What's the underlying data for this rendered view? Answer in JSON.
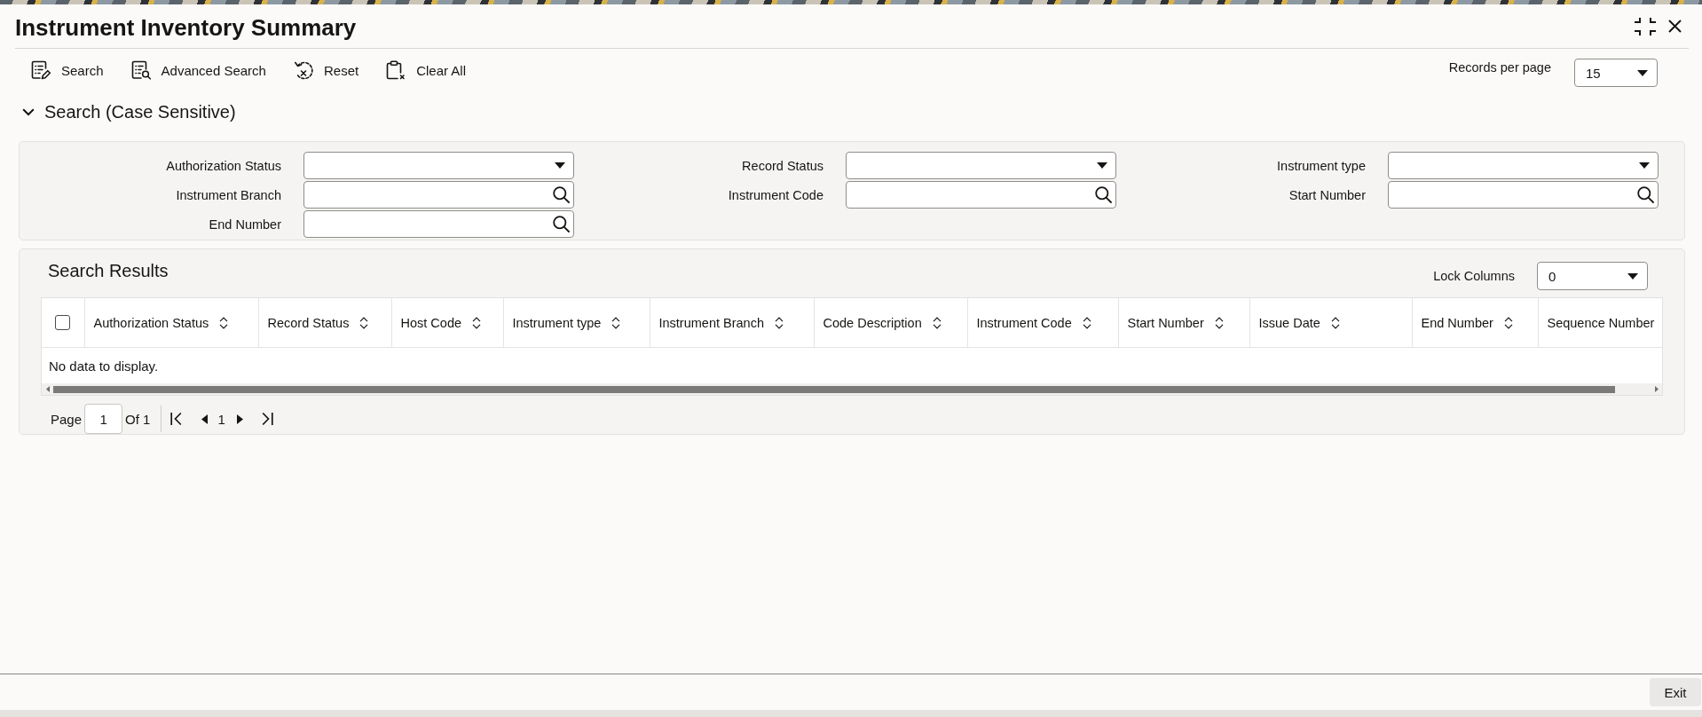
{
  "window": {
    "title": "Instrument Inventory Summary"
  },
  "toolbar": {
    "buttons": [
      {
        "label": "Search",
        "kind": "search"
      },
      {
        "label": "Advanced Search",
        "kind": "advanced"
      },
      {
        "label": "Reset",
        "kind": "reset"
      },
      {
        "label": "Clear All",
        "kind": "clear"
      }
    ],
    "records_per_page": {
      "label": "Records per page",
      "value": "15"
    }
  },
  "search_section": {
    "title": "Search (Case Sensitive)",
    "expanded": true,
    "fields": [
      {
        "label": "Authorization Status",
        "kind": "dropdown"
      },
      {
        "label": "Record Status",
        "kind": "dropdown"
      },
      {
        "label": "Instrument type",
        "kind": "dropdown"
      },
      {
        "label": "Instrument Branch",
        "kind": "lookup"
      },
      {
        "label": "Instrument Code",
        "kind": "lookup"
      },
      {
        "label": "Start Number",
        "kind": "lookup"
      },
      {
        "label": "End Number",
        "kind": "lookup"
      }
    ]
  },
  "results": {
    "title": "Search Results",
    "lock_columns": {
      "label": "Lock Columns",
      "value": "0"
    },
    "table": {
      "select_all": {
        "checked": false
      },
      "columns": [
        {
          "label": "Authorization Status"
        },
        {
          "label": "Record Status"
        },
        {
          "label": "Host Code"
        },
        {
          "label": "Instrument type"
        },
        {
          "label": "Instrument Branch"
        },
        {
          "label": "Code Description"
        },
        {
          "label": "Instrument Code"
        },
        {
          "label": "Start Number"
        },
        {
          "label": "Issue Date"
        },
        {
          "label": "End Number"
        },
        {
          "label": "Sequence Number"
        }
      ],
      "empty_message": "No data to display."
    },
    "pagination": {
      "label": "Page",
      "page": "1",
      "total": "Of 1",
      "current": "1"
    }
  },
  "footer": {
    "button": "Exit"
  }
}
